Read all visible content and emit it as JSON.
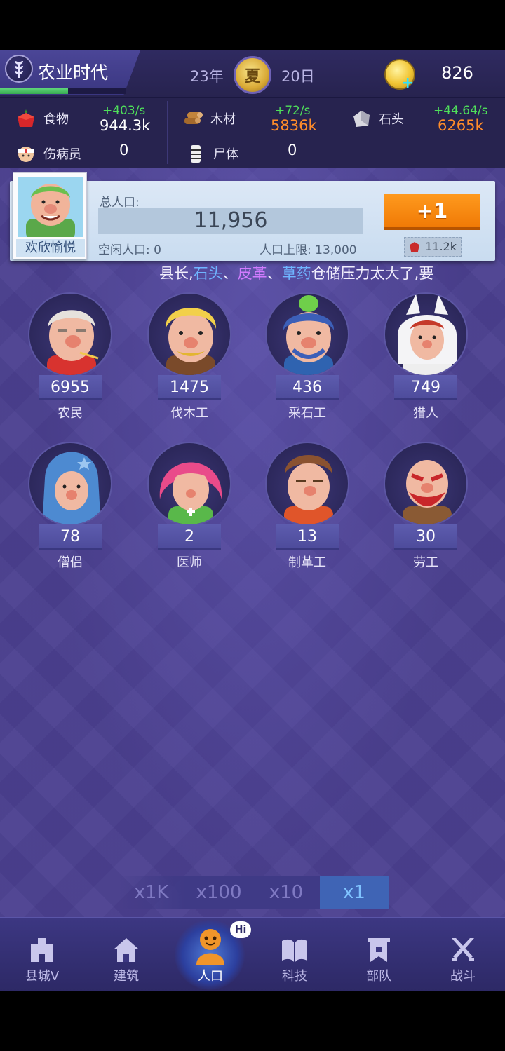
{
  "era": {
    "title": "农业时代",
    "progress": 0.54
  },
  "season": {
    "year": "23年",
    "name": "夏",
    "day": "20日"
  },
  "coins": {
    "value": "826"
  },
  "resources": {
    "food": {
      "label": "食物",
      "rate": "+403/s",
      "amount": "944.3k",
      "amount_color": "#ffffff"
    },
    "wood": {
      "label": "木材",
      "rate": "+72/s",
      "amount": "5836k",
      "amount_color": "#ff8c2a"
    },
    "stone": {
      "label": "石头",
      "rate": "+44.64/s",
      "amount": "6265k",
      "amount_color": "#ff8c2a"
    },
    "injured": {
      "label": "伤病员",
      "amount": "0"
    },
    "corpse": {
      "label": "尸体",
      "amount": "0"
    }
  },
  "population": {
    "mood": "欢欣愉悦",
    "total_label": "总人口:",
    "total": "11,956",
    "idle_label": "空闲人口: 0",
    "cap_label": "人口上限: 13,000",
    "add_button": "+1",
    "cost": "11.2k"
  },
  "ticker": {
    "prefix": "县长,",
    "item1": "石头",
    "sep1": "、",
    "item2": "皮革",
    "sep2": "、",
    "item3": "草药",
    "suffix": "仓储压力太大了,要"
  },
  "workers": [
    {
      "name": "农民",
      "count": "6955"
    },
    {
      "name": "伐木工",
      "count": "1475"
    },
    {
      "name": "采石工",
      "count": "436"
    },
    {
      "name": "猎人",
      "count": "749"
    },
    {
      "name": "僧侣",
      "count": "78"
    },
    {
      "name": "医师",
      "count": "2"
    },
    {
      "name": "制革工",
      "count": "13"
    },
    {
      "name": "劳工",
      "count": "30"
    }
  ],
  "multipliers": [
    "x1K",
    "x100",
    "x10",
    "x1"
  ],
  "multiplier_active": "x1",
  "nav": [
    {
      "label": "县城V",
      "icon": "town-icon"
    },
    {
      "label": "建筑",
      "icon": "house-icon"
    },
    {
      "label": "人口",
      "icon": "person-icon"
    },
    {
      "label": "科技",
      "icon": "book-icon"
    },
    {
      "label": "部队",
      "icon": "banner-icon"
    },
    {
      "label": "战斗",
      "icon": "swords-icon"
    }
  ],
  "nav_badge": "Hi",
  "colors": {
    "accent_orange": "#f07a06",
    "rate_green": "#4fe05a",
    "background": "#4a3f8f"
  }
}
